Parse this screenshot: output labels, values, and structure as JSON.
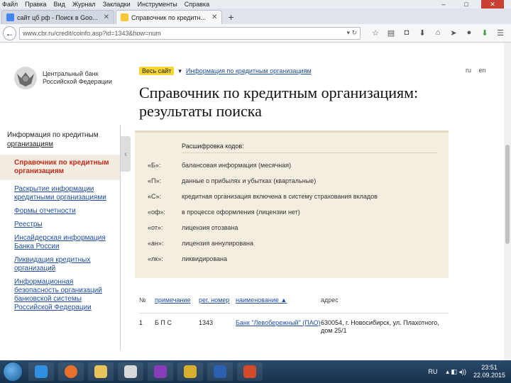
{
  "menubar": {
    "items": [
      "Файл",
      "Правка",
      "Вид",
      "Журнал",
      "Закладки",
      "Инструменты",
      "Справка"
    ]
  },
  "tabs": [
    {
      "label": "сайт цб рф - Поиск в Goo...",
      "fav_color": "#4285f4"
    },
    {
      "label": "Справочник по кредитн...",
      "fav_color": "#f7c934"
    }
  ],
  "nav": {
    "url": "www.cbr.ru/credit/coinfo.asp?id=1343&how=num"
  },
  "logo": {
    "line1": "Центральный банк",
    "line2": "Российской Федерации"
  },
  "topbar": {
    "site_label": "Весь сайт",
    "crumb": "Информация по кредитным организациям",
    "lang_ru": "ru",
    "lang_en": "en"
  },
  "page_title": "Справочник по кредитным организациям: результаты поиска",
  "sidebar": {
    "title_prefix": "Информация по кредитным",
    "title_link": "организациям",
    "active": "Справочник по кредитным организациям",
    "links": [
      "Раскрытие информации кредитными организациями",
      "Формы отчетности",
      "Реестры",
      "Инсайдерская информация Банка России",
      "Ликвидация кредитных организаций",
      "Информационная безопасность организаций банковской системы Российской Федерации"
    ]
  },
  "legend": {
    "heading": "Расшифровка кодов:",
    "rows": [
      {
        "code": "«Б»:",
        "desc": "балансовая информация (месячная)"
      },
      {
        "code": "«П»:",
        "desc": "данные о прибылях и убытках (квартальные)"
      },
      {
        "code": "«С»:",
        "desc": "кредитная организация включена в систему страхования вкладов"
      },
      {
        "code": "«оф»:",
        "desc": "в процессе оформления (лицензии нет)"
      },
      {
        "code": "«от»:",
        "desc": "лицензия отозвана"
      },
      {
        "code": "«ан»:",
        "desc": "лицензия аннулирована"
      },
      {
        "code": "«лк»:",
        "desc": "ликвидирована"
      }
    ]
  },
  "table": {
    "headers": [
      "№",
      "примечание",
      "рег. номер",
      "наименование ▲",
      "адрес"
    ],
    "rows": [
      {
        "num": "1",
        "note": "Б П С",
        "reg": "1343",
        "name": "Банк \"Левобережный\" (ПАО)",
        "address": "630054, г. Новосибирск, ул. Плахотного, дом 25/1"
      }
    ]
  },
  "taskbar": {
    "lang": "RU",
    "time": "23:51",
    "date": "22.09.2015"
  }
}
